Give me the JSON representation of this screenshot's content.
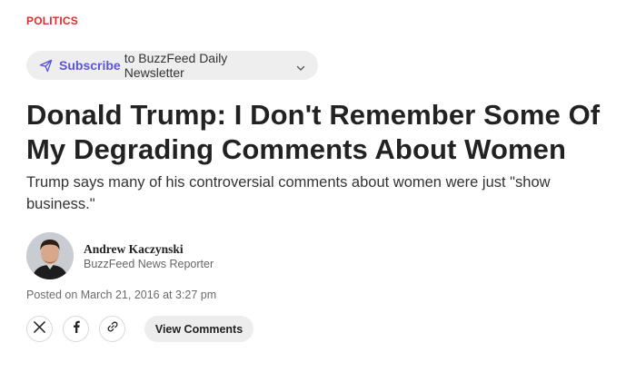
{
  "section": {
    "label": "POLITICS"
  },
  "newsletter": {
    "subscribe_label": "Subscribe",
    "rest_label": "to BuzzFeed Daily Newsletter",
    "icon": "send-icon",
    "dropdown_icon": "chevron-down-icon"
  },
  "article": {
    "headline": "Donald Trump: I Don't Remember Some Of My Degrading Comments About Women",
    "dek": "Trump says many of his controversial comments about women were just \"show business.\""
  },
  "author": {
    "name": "Andrew Kaczynski",
    "title": "BuzzFeed News Reporter"
  },
  "posted": {
    "text": "Posted on March 21, 2016 at 3:27 pm"
  },
  "share": {
    "icons": [
      "x-icon",
      "facebook-icon",
      "link-icon"
    ],
    "comments_label": "View Comments"
  },
  "colors": {
    "section": "#e32a2a",
    "subscribe_accent": "#5a55d8",
    "pill_bg": "#eeeeee",
    "text": "#222222"
  }
}
